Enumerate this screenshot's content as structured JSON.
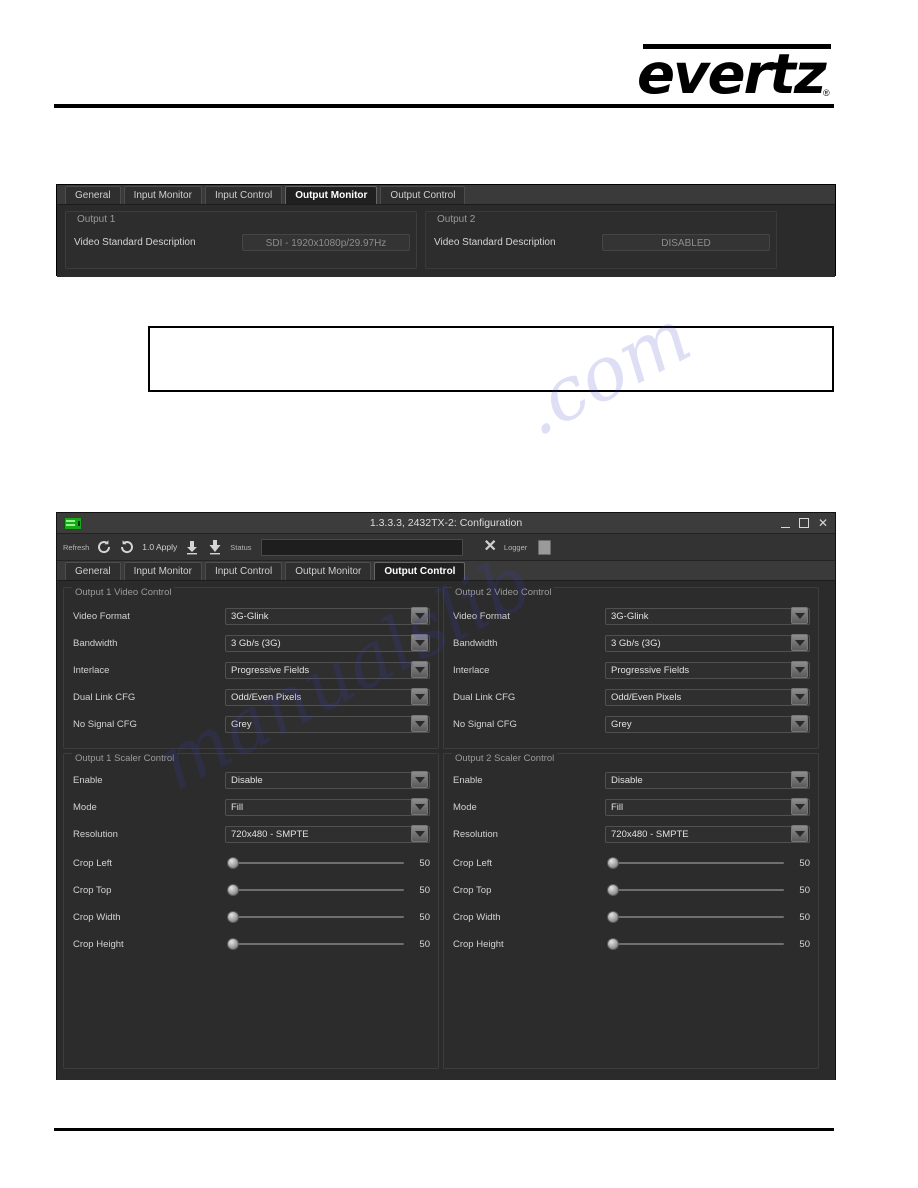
{
  "branding": {
    "logo_text": "evertz",
    "registered_mark": "®"
  },
  "top_panel": {
    "tabs": [
      {
        "label": "General",
        "active": false
      },
      {
        "label": "Input Monitor",
        "active": false
      },
      {
        "label": "Input Control",
        "active": false
      },
      {
        "label": "Output Monitor",
        "active": true
      },
      {
        "label": "Output Control",
        "active": false
      }
    ],
    "output1": {
      "group_title": "Output 1",
      "field_label": "Video Standard Description",
      "field_value": "SDI - 1920x1080p/29.97Hz"
    },
    "output2": {
      "group_title": "Output 2",
      "field_label": "Video Standard Description",
      "field_value": "DISABLED"
    }
  },
  "window": {
    "title": "1.3.3.3, 2432TX-2: Configuration",
    "icon": "card-icon",
    "controls": {
      "minimize": "minimize-icon",
      "maximize": "maximize-icon",
      "close": "✕"
    },
    "toolbar": {
      "refresh_label": "Refresh",
      "refresh_icon": "refresh-icon",
      "reload_icon": "reload-icon",
      "apply_label": "1.0 Apply",
      "download_icon": "download-icon",
      "download_all_icon": "download-all-icon",
      "status_label": "Status",
      "status_value": "",
      "close_icon": "✕",
      "logger_label": "Logger",
      "logger_icon": "logger-icon"
    },
    "tabs": [
      {
        "label": "General",
        "active": false
      },
      {
        "label": "Input Monitor",
        "active": false
      },
      {
        "label": "Input Control",
        "active": false
      },
      {
        "label": "Output Monitor",
        "active": false
      },
      {
        "label": "Output Control",
        "active": true
      }
    ],
    "output1_video": {
      "group_title": "Output 1 Video Control",
      "rows": [
        {
          "label": "Video Format",
          "value": "3G-Glink"
        },
        {
          "label": "Bandwidth",
          "value": "3 Gb/s (3G)"
        },
        {
          "label": "Interlace",
          "value": "Progressive Fields"
        },
        {
          "label": "Dual Link CFG",
          "value": "Odd/Even Pixels"
        },
        {
          "label": "No Signal CFG",
          "value": "Grey"
        }
      ]
    },
    "output2_video": {
      "group_title": "Output 2 Video Control",
      "rows": [
        {
          "label": "Video Format",
          "value": "3G-Glink"
        },
        {
          "label": "Bandwidth",
          "value": "3 Gb/s (3G)"
        },
        {
          "label": "Interlace",
          "value": "Progressive Fields"
        },
        {
          "label": "Dual Link CFG",
          "value": "Odd/Even Pixels"
        },
        {
          "label": "No Signal CFG",
          "value": "Grey"
        }
      ]
    },
    "output1_scaler": {
      "group_title": "Output 1 Scaler Control",
      "combos": [
        {
          "label": "Enable",
          "value": "Disable"
        },
        {
          "label": "Mode",
          "value": "Fill"
        },
        {
          "label": "Resolution",
          "value": "720x480 - SMPTE"
        }
      ],
      "sliders": [
        {
          "label": "Crop Left",
          "value": "50"
        },
        {
          "label": "Crop Top",
          "value": "50"
        },
        {
          "label": "Crop Width",
          "value": "50"
        },
        {
          "label": "Crop Height",
          "value": "50"
        }
      ]
    },
    "output2_scaler": {
      "group_title": "Output 2 Scaler Control",
      "combos": [
        {
          "label": "Enable",
          "value": "Disable"
        },
        {
          "label": "Mode",
          "value": "Fill"
        },
        {
          "label": "Resolution",
          "value": "720x480 - SMPTE"
        }
      ],
      "sliders": [
        {
          "label": "Crop Left",
          "value": "50"
        },
        {
          "label": "Crop Top",
          "value": "50"
        },
        {
          "label": "Crop Width",
          "value": "50"
        },
        {
          "label": "Crop Height",
          "value": "50"
        }
      ]
    }
  },
  "watermark": {
    "line1": "manualslib",
    "line2": ".com"
  },
  "colors": {
    "window_bg": "#2b2b2b",
    "titlebar_bg": "#3c3c3c",
    "accent_green": "#18a818",
    "text_primary": "#d2d2d2",
    "text_dim": "#9b9b9b"
  }
}
